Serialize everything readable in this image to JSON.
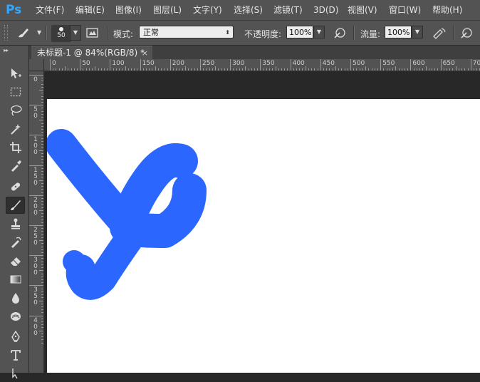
{
  "app": {
    "logo": "Ps",
    "menu": [
      "文件(F)",
      "编辑(E)",
      "图像(I)",
      "图层(L)",
      "文字(Y)",
      "选择(S)",
      "滤镜(T)",
      "3D(D)",
      "视图(V)",
      "窗口(W)",
      "帮助(H)"
    ]
  },
  "options": {
    "brush_size": "50",
    "mode_label": "模式:",
    "mode_value": "正常",
    "opacity_label": "不透明度:",
    "opacity_value": "100%",
    "flow_label": "流量:",
    "flow_value": "100%"
  },
  "document": {
    "tab_title": "未标题-1 @ 84%(RGB/8) *",
    "close_symbol": "×"
  },
  "rulers": {
    "h_labels": [
      "0",
      "50",
      "100",
      "150",
      "200",
      "250",
      "300",
      "350",
      "400",
      "450",
      "500",
      "550",
      "600",
      "650",
      "700"
    ],
    "v_labels": [
      "0",
      "5\n0",
      "1\n0\n0",
      "1\n5\n0",
      "2\n0\n0",
      "2\n5\n0",
      "3\n0\n0",
      "3\n5\n0",
      "4\n0\n0"
    ]
  },
  "colors": {
    "brush_stroke": "#2b66ff",
    "ui_dark": "#535353",
    "canvas": "#ffffff"
  },
  "icons": {
    "toolbar": [
      "move-icon",
      "marquee-icon",
      "lasso-icon",
      "magic-wand-icon",
      "crop-icon",
      "eyedropper-icon",
      "healing-brush-icon",
      "brush-icon",
      "clone-stamp-icon",
      "history-brush-icon",
      "eraser-icon",
      "gradient-icon",
      "blur-icon",
      "dodge-icon",
      "pen-icon",
      "type-icon",
      "path-selection-icon"
    ]
  }
}
